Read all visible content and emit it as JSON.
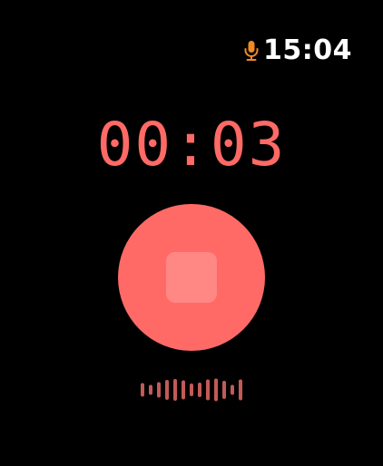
{
  "status_bar": {
    "time": "15:04",
    "mic_icon": "microphone-icon",
    "mic_color": "#F08A23"
  },
  "recorder": {
    "elapsed": "00:03",
    "accent_color": "#FF6A66",
    "button_icon": "stop-icon",
    "waveform_color": "#C25A57"
  },
  "waveform": {
    "levels": [
      0.45,
      0.25,
      0.55,
      0.8,
      0.9,
      0.75,
      0.4,
      0.5,
      0.85,
      0.95,
      0.7,
      0.25,
      0.85
    ]
  }
}
